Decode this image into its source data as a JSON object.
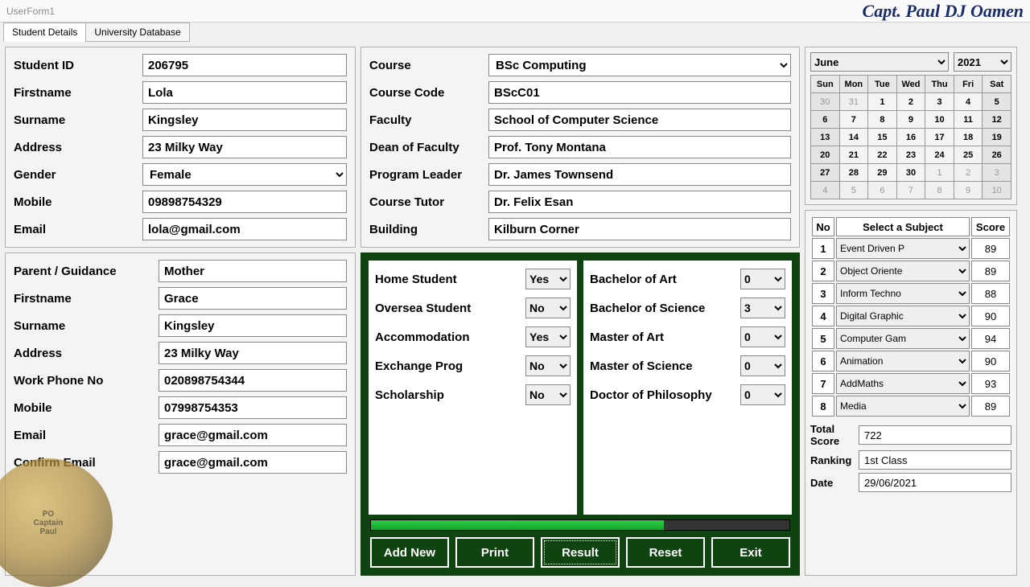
{
  "window_title": "UserForm1",
  "brand": "Capt. Paul DJ Oamen",
  "tabs": [
    "Student Details",
    "University Database"
  ],
  "student": {
    "id_label": "Student ID",
    "id": "206795",
    "first_label": "Firstname",
    "first": "Lola",
    "sur_label": "Surname",
    "sur": "Kingsley",
    "addr_label": "Address",
    "addr": "23 Milky Way",
    "gender_label": "Gender",
    "gender": "Female",
    "mobile_label": "Mobile",
    "mobile": "09898754329",
    "email_label": "Email",
    "email": "lola@gmail.com"
  },
  "guardian": {
    "rel_label": "Parent / Guidance",
    "rel": "Mother",
    "first_label": "Firstname",
    "first": "Grace",
    "sur_label": "Surname",
    "sur": "Kingsley",
    "addr_label": "Address",
    "addr": "23 Milky Way",
    "work_label": "Work Phone No",
    "work": "020898754344",
    "mobile_label": "Mobile",
    "mobile": "07998754353",
    "email_label": "Email",
    "email": "grace@gmail.com",
    "confirm_label": "Confirm Email",
    "confirm": "grace@gmail.com"
  },
  "course": {
    "course_label": "Course",
    "course": "BSc Computing",
    "code_label": "Course Code",
    "code": "BScC01",
    "faculty_label": "Faculty",
    "faculty": "School of Computer Science",
    "dean_label": "Dean of Faculty",
    "dean": "Prof. Tony Montana",
    "leader_label": "Program Leader",
    "leader": "Dr. James Townsend",
    "tutor_label": "Course Tutor",
    "tutor": "Dr. Felix Esan",
    "building_label": "Building",
    "building": "Kilburn Corner"
  },
  "status": {
    "home_label": "Home Student",
    "home": "Yes",
    "oversea_label": "Oversea  Student",
    "oversea": "No",
    "accom_label": "Accommodation",
    "accom": "Yes",
    "exchange_label": "Exchange Prog",
    "exchange": "No",
    "scholar_label": "Scholarship",
    "scholar": "No"
  },
  "degrees": {
    "ba_label": "Bachelor of Art",
    "ba": "0",
    "bsc_label": "Bachelor of Science",
    "bsc": "3",
    "ma_label": "Master of Art",
    "ma": "0",
    "msc_label": "Master of  Science",
    "msc": "0",
    "phd_label": "Doctor of Philosophy",
    "phd": "0"
  },
  "buttons": {
    "add": "Add New",
    "print": "Print",
    "result": "Result",
    "reset": "Reset",
    "exit": "Exit"
  },
  "calendar": {
    "month": "June",
    "year": "2021",
    "dow": [
      "Sun",
      "Mon",
      "Tue",
      "Wed",
      "Thu",
      "Fri",
      "Sat"
    ],
    "weeks": [
      [
        {
          "d": "30",
          "dim": true
        },
        {
          "d": "31",
          "dim": true
        },
        {
          "d": "1"
        },
        {
          "d": "2"
        },
        {
          "d": "3"
        },
        {
          "d": "4"
        },
        {
          "d": "5"
        }
      ],
      [
        {
          "d": "6"
        },
        {
          "d": "7"
        },
        {
          "d": "8"
        },
        {
          "d": "9"
        },
        {
          "d": "10"
        },
        {
          "d": "11"
        },
        {
          "d": "12"
        }
      ],
      [
        {
          "d": "13"
        },
        {
          "d": "14"
        },
        {
          "d": "15"
        },
        {
          "d": "16"
        },
        {
          "d": "17"
        },
        {
          "d": "18"
        },
        {
          "d": "19"
        }
      ],
      [
        {
          "d": "20"
        },
        {
          "d": "21"
        },
        {
          "d": "22"
        },
        {
          "d": "23"
        },
        {
          "d": "24"
        },
        {
          "d": "25"
        },
        {
          "d": "26"
        }
      ],
      [
        {
          "d": "27"
        },
        {
          "d": "28"
        },
        {
          "d": "29"
        },
        {
          "d": "30"
        },
        {
          "d": "1",
          "dim": true
        },
        {
          "d": "2",
          "dim": true
        },
        {
          "d": "3",
          "dim": true
        }
      ],
      [
        {
          "d": "4",
          "dim": true
        },
        {
          "d": "5",
          "dim": true
        },
        {
          "d": "6",
          "dim": true
        },
        {
          "d": "7",
          "dim": true
        },
        {
          "d": "8",
          "dim": true
        },
        {
          "d": "9",
          "dim": true
        },
        {
          "d": "10",
          "dim": true
        }
      ]
    ]
  },
  "subjects": {
    "head_no": "No",
    "head_sel": "Select a Subject",
    "head_score": "Score",
    "rows": [
      {
        "no": "1",
        "subj": "Event Driven P",
        "score": "89"
      },
      {
        "no": "2",
        "subj": "Object Oriente",
        "score": "89"
      },
      {
        "no": "3",
        "subj": "Inform Techno",
        "score": "88"
      },
      {
        "no": "4",
        "subj": "Digital Graphic",
        "score": "90"
      },
      {
        "no": "5",
        "subj": "Computer Gam",
        "score": "94"
      },
      {
        "no": "6",
        "subj": "Animation",
        "score": "90"
      },
      {
        "no": "7",
        "subj": "AddMaths",
        "score": "93"
      },
      {
        "no": "8",
        "subj": "Media",
        "score": "89"
      }
    ]
  },
  "totals": {
    "total_label": "Total Score",
    "total": "722",
    "rank_label": "Ranking",
    "rank": "1st Class",
    "date_label": "Date",
    "date": "29/06/2021"
  },
  "watermark": {
    "line1": "PO",
    "line2": "Captain",
    "line3": "Paul"
  }
}
